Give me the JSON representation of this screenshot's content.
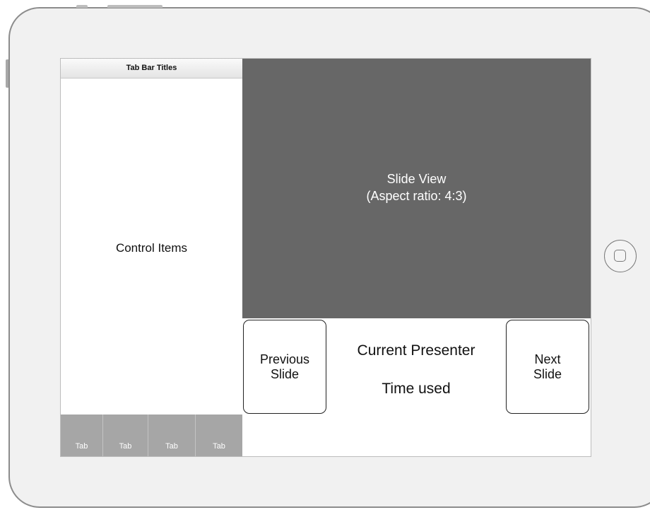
{
  "left_panel": {
    "tab_bar_title": "Tab Bar Titles",
    "control_items_label": "Control Items",
    "tabs": [
      {
        "label": "Tab"
      },
      {
        "label": "Tab"
      },
      {
        "label": "Tab"
      },
      {
        "label": "Tab"
      }
    ]
  },
  "slide_view": {
    "title": "Slide View",
    "subtitle": "(Aspect ratio: 4:3)"
  },
  "controls": {
    "previous_line1": "Previous",
    "previous_line2": "Slide",
    "next_line1": "Next",
    "next_line2": "Slide",
    "current_presenter": "Current Presenter",
    "time_used": "Time used"
  },
  "colors": {
    "slide_background": "#676767",
    "tab_background": "#a6a6a6",
    "device_frame": "#f1f1f1"
  },
  "icons": {
    "home_button": "home-button-icon"
  }
}
